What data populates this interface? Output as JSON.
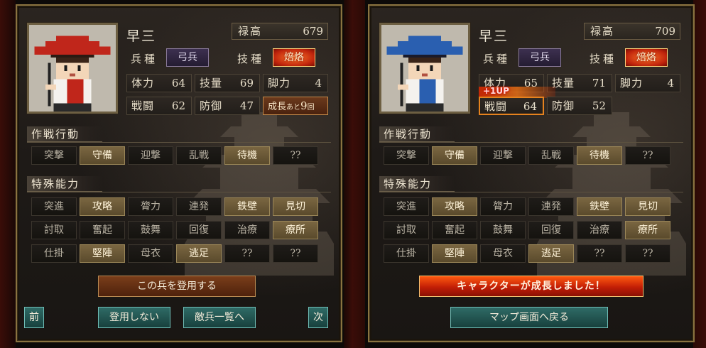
{
  "left_panel": {
    "name": "早三",
    "stipend": {
      "label": "禄高",
      "value": "679"
    },
    "type_label": "兵種",
    "type_value": "弓兵",
    "skill_label": "技種",
    "skill_value": "焙烙",
    "stats": [
      {
        "label": "体力",
        "value": "64"
      },
      {
        "label": "技量",
        "value": "69"
      },
      {
        "label": "脚力",
        "value": "4"
      },
      {
        "label": "戦闘",
        "value": "62"
      },
      {
        "label": "防御",
        "value": "47"
      }
    ],
    "growth": {
      "label": "成長",
      "small": "あと",
      "count": "9",
      "unit": "回"
    },
    "tactics_title": "作戦行動",
    "tactics": [
      {
        "label": "突撃",
        "active": false
      },
      {
        "label": "守備",
        "active": true
      },
      {
        "label": "迎撃",
        "active": false
      },
      {
        "label": "乱戦",
        "active": false
      },
      {
        "label": "待機",
        "active": true
      },
      {
        "label": "??",
        "active": false
      }
    ],
    "abilities_title": "特殊能力",
    "abilities": [
      {
        "label": "突進",
        "active": false
      },
      {
        "label": "攻略",
        "active": true
      },
      {
        "label": "膂力",
        "active": false
      },
      {
        "label": "連発",
        "active": false
      },
      {
        "label": "鉄壁",
        "active": true
      },
      {
        "label": "見切",
        "active": true
      },
      {
        "label": "討取",
        "active": false
      },
      {
        "label": "奮起",
        "active": false
      },
      {
        "label": "鼓舞",
        "active": false
      },
      {
        "label": "回復",
        "active": false
      },
      {
        "label": "治療",
        "active": false
      },
      {
        "label": "療所",
        "active": true
      },
      {
        "label": "仕掛",
        "active": false
      },
      {
        "label": "堅陣",
        "active": true
      },
      {
        "label": "母衣",
        "active": false
      },
      {
        "label": "逃足",
        "active": true
      },
      {
        "label": "??",
        "active": false
      },
      {
        "label": "??",
        "active": false
      }
    ],
    "recruit_button": "この兵を登用する",
    "prev_button": "前",
    "decline_button": "登用しない",
    "enemy_list_button": "敵兵一覧へ",
    "next_button": "次",
    "hat_color": "#c0261b"
  },
  "right_panel": {
    "name": "早三",
    "stipend": {
      "label": "禄高",
      "value": "709"
    },
    "type_label": "兵種",
    "type_value": "弓兵",
    "skill_label": "技種",
    "skill_value": "焙烙",
    "stats": [
      {
        "label": "体力",
        "value": "65"
      },
      {
        "label": "技量",
        "value": "71"
      },
      {
        "label": "脚力",
        "value": "4"
      },
      {
        "label": "戦闘",
        "value": "64"
      },
      {
        "label": "防御",
        "value": "52"
      }
    ],
    "levelup_text": "+1UP",
    "tactics_title": "作戦行動",
    "tactics": [
      {
        "label": "突撃",
        "active": false
      },
      {
        "label": "守備",
        "active": true
      },
      {
        "label": "迎撃",
        "active": false
      },
      {
        "label": "乱戦",
        "active": false
      },
      {
        "label": "待機",
        "active": true
      },
      {
        "label": "??",
        "active": false
      }
    ],
    "abilities_title": "特殊能力",
    "abilities": [
      {
        "label": "突進",
        "active": false
      },
      {
        "label": "攻略",
        "active": true
      },
      {
        "label": "膂力",
        "active": false
      },
      {
        "label": "連発",
        "active": false
      },
      {
        "label": "鉄壁",
        "active": true
      },
      {
        "label": "見切",
        "active": true
      },
      {
        "label": "討取",
        "active": false
      },
      {
        "label": "奮起",
        "active": false
      },
      {
        "label": "鼓舞",
        "active": false
      },
      {
        "label": "回復",
        "active": false
      },
      {
        "label": "治療",
        "active": false
      },
      {
        "label": "療所",
        "active": true
      },
      {
        "label": "仕掛",
        "active": false
      },
      {
        "label": "堅陣",
        "active": true
      },
      {
        "label": "母衣",
        "active": false
      },
      {
        "label": "逃足",
        "active": true
      },
      {
        "label": "??",
        "active": false
      },
      {
        "label": "??",
        "active": false
      }
    ],
    "grown_banner": "キャラクターが成長しました！",
    "map_button": "マップ画面へ戻る",
    "hat_color": "#2a5fb0"
  }
}
